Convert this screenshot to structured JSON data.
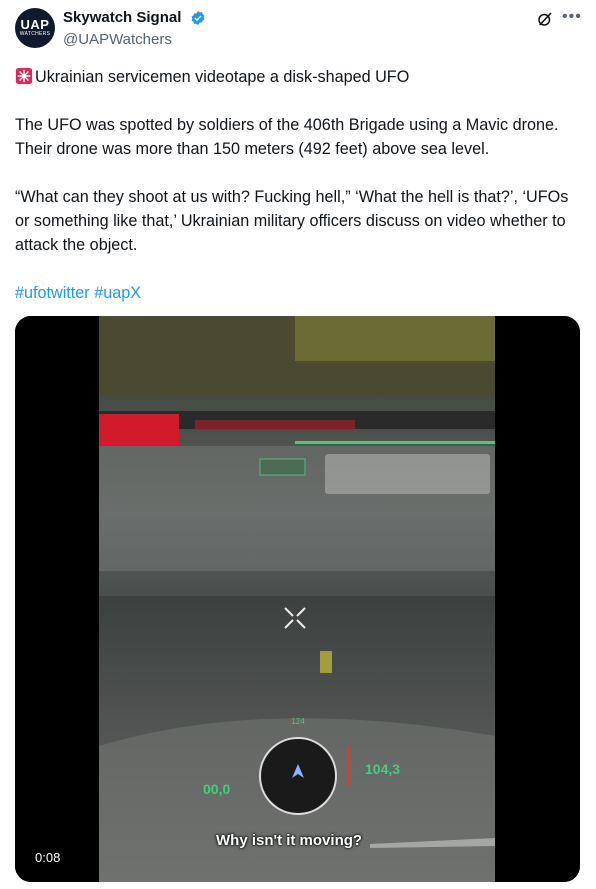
{
  "account": {
    "display_name": "Skywatch Signal",
    "handle": "@UAPWatchers",
    "avatar_text_main": "UAP",
    "avatar_text_sub": "WATCHERS",
    "verified": true
  },
  "tweet": {
    "title": "Ukrainian servicemen videotape a disk-shaped UFO",
    "paragraph1": "The  UFO was spotted by soldiers of the 406th Brigade using a Mavic drone.  Their drone was more than 150 meters (492 feet) above sea level.",
    "paragraph2": "“What  can they shoot at us with? Fucking hell,” ‘What the hell is that?’, ‘UFOs or something like that,’ Ukrainian military officers discuss on video whether to attack the object.",
    "hashtags": [
      "#ufotwitter",
      "#uapX"
    ]
  },
  "video": {
    "subtitle": "Why isn't it moving?",
    "timestamp": "0:08",
    "hud_left_value": "00,0",
    "hud_right_value": "104,3",
    "hud_heading": "124"
  },
  "icons": [
    "verified-badge-icon",
    "grok-icon",
    "more-options-icon",
    "siren-emoji-icon"
  ],
  "colors": {
    "accent": "#1d9bf0",
    "text": "#0f1419",
    "secondary": "#536471"
  }
}
